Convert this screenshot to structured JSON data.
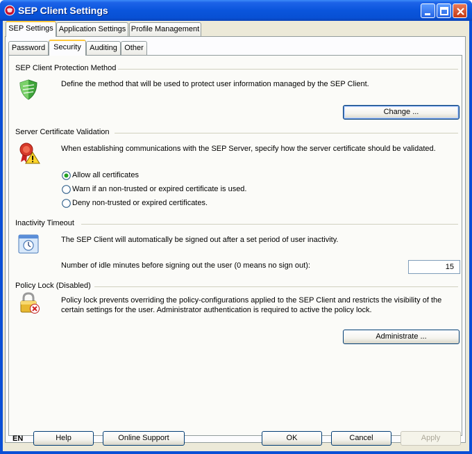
{
  "window": {
    "title": "SEP Client Settings"
  },
  "tabs": {
    "main": [
      "SEP Settings",
      "Application Settings",
      "Profile Management"
    ],
    "sub": [
      "Password",
      "Security",
      "Auditing",
      "Other"
    ]
  },
  "protection": {
    "heading": "SEP Client Protection Method",
    "description": "Define the method that will be used to protect user information managed by the SEP Client.",
    "button": "Change ..."
  },
  "certificate": {
    "heading": "Server Certificate Validation",
    "description": "When establishing communications with the SEP Server, specify how the server certificate should be validated.",
    "options": [
      "Allow all certificates",
      "Warn if an non-trusted or expired certificate is used.",
      "Deny non-trusted or expired certificates."
    ],
    "selected_index": 0
  },
  "inactivity": {
    "heading": "Inactivity Timeout",
    "description": "The SEP Client will automatically be signed out after a set period of user inactivity.",
    "field_label": "Number of idle minutes before signing out the user (0 means no sign out):",
    "field_value": "15"
  },
  "policy": {
    "heading": "Policy Lock (Disabled)",
    "description": "Policy lock prevents overriding the policy-configurations applied to the SEP Client and restricts the visibility of the certain settings for the user. Administrator authentication is required to active the policy lock.",
    "button": "Administrate ..."
  },
  "footer": {
    "language": "EN",
    "help": "Help",
    "online_support": "Online Support",
    "ok": "OK",
    "cancel": "Cancel",
    "apply": "Apply"
  }
}
